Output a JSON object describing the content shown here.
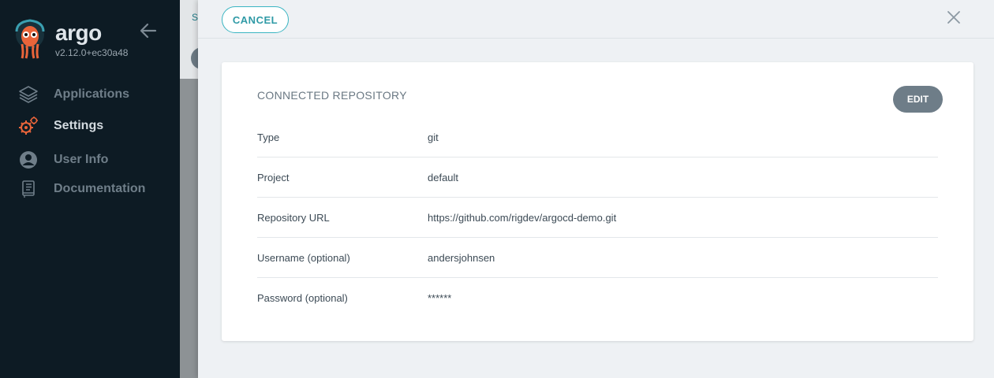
{
  "sidebar": {
    "brand": "argo",
    "version": "v2.12.0+ec30a48",
    "items": [
      {
        "label": "Applications",
        "icon": "layers-icon",
        "active": false
      },
      {
        "label": "Settings",
        "icon": "gears-icon",
        "active": true
      },
      {
        "label": "User Info",
        "icon": "user-circle-icon",
        "active": false
      },
      {
        "label": "Documentation",
        "icon": "book-icon",
        "active": false
      }
    ]
  },
  "background": {
    "breadcrumb_fragment": "S"
  },
  "panel": {
    "cancel_label": "CANCEL",
    "card": {
      "title": "CONNECTED REPOSITORY",
      "edit_label": "EDIT",
      "rows": [
        {
          "key": "Type",
          "value": "git"
        },
        {
          "key": "Project",
          "value": "default"
        },
        {
          "key": "Repository URL",
          "value": "https://github.com/rigdev/argocd-demo.git"
        },
        {
          "key": "Username (optional)",
          "value": "andersjohnsen"
        },
        {
          "key": "Password (optional)",
          "value": "******"
        }
      ]
    }
  },
  "colors": {
    "sidebar_bg": "#0d1b24",
    "accent_teal": "#3ab5c2",
    "edit_button": "#6e7d88",
    "logo_orange": "#e9643a"
  }
}
